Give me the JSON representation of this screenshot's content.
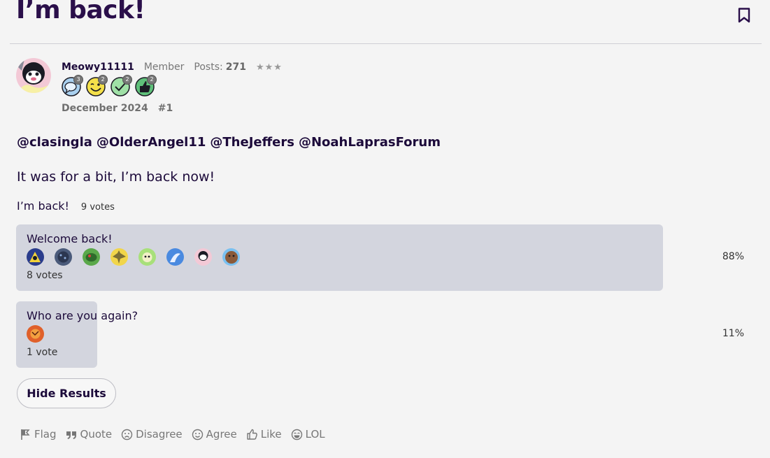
{
  "discussion": {
    "title": "I’m back!"
  },
  "post": {
    "author": {
      "username": "Meowy11111",
      "role": "Member",
      "posts_label": "Posts:",
      "posts_count": "271",
      "rank_stars": "★★★"
    },
    "badges": [
      {
        "icon": "speech-bubble-icon",
        "count": "3"
      },
      {
        "icon": "winking-face-icon",
        "count": "2"
      },
      {
        "icon": "checkmark-icon",
        "count": "2"
      },
      {
        "icon": "thumbs-up-icon",
        "count": "2"
      }
    ],
    "date": "December 2024",
    "number": "#1",
    "mentions": [
      "@clasingla",
      "@OlderAngel11",
      "@TheJeffers",
      "@NoahLaprasForum"
    ],
    "body": "It was for a bit, I’m back now!"
  },
  "poll": {
    "title": "I’m back!",
    "total_votes": "9 votes",
    "options": [
      {
        "label": "Welcome back!",
        "votes": "8 votes",
        "percent": "88%",
        "fraction": 0.88
      },
      {
        "label": "Who are you again?",
        "votes": "1 vote",
        "percent": "11%",
        "fraction": 0.11
      }
    ],
    "hide_results_label": "Hide Results"
  },
  "reactions": [
    {
      "icon": "flag-icon",
      "label": "Flag"
    },
    {
      "icon": "quote-icon",
      "label": "Quote"
    },
    {
      "icon": "frown-face-icon",
      "label": "Disagree"
    },
    {
      "icon": "smile-face-icon",
      "label": "Agree"
    },
    {
      "icon": "thumbs-up-icon",
      "label": "Like"
    },
    {
      "icon": "laughing-face-icon",
      "label": "LOL"
    }
  ],
  "colors": {
    "background": "#f4f4f4",
    "text": "#1c0a3a",
    "poll_fill": "#d3d5de",
    "muted": "#777777"
  }
}
